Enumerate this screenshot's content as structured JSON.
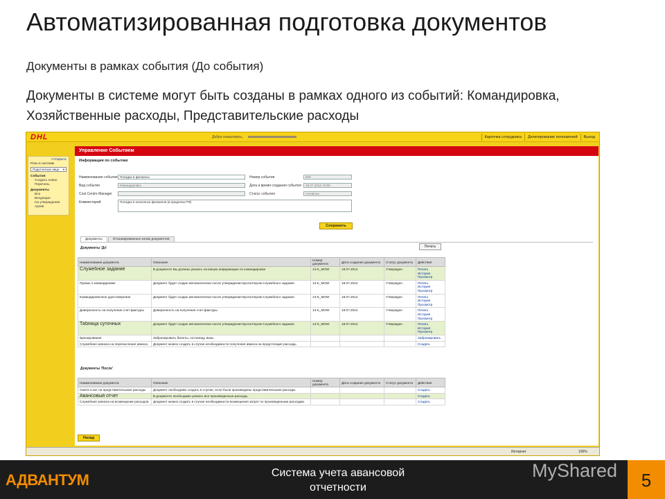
{
  "slide": {
    "title": "Автоматизированная подготовка документов",
    "subtitle": "Документы в рамках события (До события)",
    "body": "Документы в системе могут быть созданы в рамках одного из событий: Командировка, Хозяйственные расходы, Представительские расходы"
  },
  "app": {
    "logo": "DHL",
    "welcome": "Добро пожаловать,",
    "top_links": [
      "Карточка сотрудника",
      "Делегирование полномочий",
      "Выход"
    ],
    "page_title": "Управление Событием",
    "sidebar": {
      "hide": "<<Скрыть",
      "role_label": "Роль в системе",
      "role_value": "Подотчетное лицо",
      "events_label": "События",
      "events_items": [
        "Создать новое",
        "Перечень"
      ],
      "docs_label": "Документы",
      "docs_items": [
        "Все",
        "Входящие",
        "На утверждение",
        "Архив"
      ]
    },
    "info_title": "Информация по событию",
    "form": {
      "event_name_label": "Наименование события",
      "event_name_value": "Поездка в филиалы",
      "event_number_label": "Номер события",
      "event_number_value": "809",
      "event_type_label": "Вид события",
      "event_type_value": "Командировка",
      "created_label": "Дата и время создания события",
      "created_value": "18.07.2012 10:08",
      "ccm_label": "Cost Centre Manager",
      "status_label": "Статус события",
      "status_value": "Активное",
      "comment_label": "Комментарий",
      "comment_value": "Поездка в несколько филиалов (в пределах РФ)",
      "save_button": "Сохранить"
    },
    "tabs": [
      "Документы",
      "Отсканированные копии документов"
    ],
    "print_button": "Печать",
    "docs_before_label": "Документы 'До'",
    "docs_after_label": "Документы 'После'",
    "columns": [
      "Наименование документа",
      "Описание",
      "Номер документа",
      "Дата создания документа",
      "Статус документа",
      "Действия"
    ],
    "rows_before": [
      {
        "name": "Служебное задание",
        "desc": "В документе Вы должны указать основную информацию по командировке",
        "num": "13-K_MOW",
        "date": "18.07.2012",
        "status": "Утвержден",
        "actions": [
          "Печать",
          "История",
          "Просмотр"
        ],
        "hl": true
      },
      {
        "name": "Приказ о командировке",
        "desc": "Документ будет создан автоматически после утверждения Бухгалтером Служебного задания.",
        "num": "13-K_MOW",
        "date": "18.07.2012",
        "status": "Утвержден",
        "actions": [
          "Печать",
          "История",
          "Просмотр"
        ],
        "hl": false
      },
      {
        "name": "Командировочное удостоверение",
        "desc": "Документ будет создан автоматически после утверждения Бухгалтером Служебного задания.",
        "num": "13-K_MOW",
        "date": "18.07.2012",
        "status": "Утвержден",
        "actions": [
          "Печать",
          "История",
          "Просмотр"
        ],
        "hl": false
      },
      {
        "name": "Доверенность на получение счет-фактуры",
        "desc": "Доверенность на получение счет-фактуры",
        "num": "13-K_MOW",
        "date": "18.07.2012",
        "status": "Утвержден",
        "actions": [
          "Печать",
          "История",
          "Просмотр"
        ],
        "hl": false
      },
      {
        "name": "Таблица суточных",
        "desc": "Документ будет создан автоматически после утверждения Бухгалтером Служебного задания.",
        "num": "13-K_MOW",
        "date": "18.07.2012",
        "status": "Утвержден",
        "actions": [
          "Печать",
          "История",
          "Просмотр"
        ],
        "hl": true
      },
      {
        "name": "Бронирование",
        "desc": "Забронировать билеты, гостиницу, визы",
        "num": "",
        "date": "",
        "status": "",
        "actions": [
          "Забронировать"
        ],
        "hl": false
      },
      {
        "name": "Служебная записка на перечисление аванса",
        "desc": "Документ можно создать в случае необходимости получения аванса на предстоящие расходы.",
        "num": "",
        "date": "",
        "status": "",
        "actions": [
          "Создать"
        ],
        "hl": false
      }
    ],
    "rows_after": [
      {
        "name": "Смета и акт на представительские расходы",
        "desc": "Документ необходимо создать в случае, если были произведены представительские расходы.",
        "num": "",
        "date": "",
        "status": "",
        "actions": [
          "Создать"
        ],
        "hl": false
      },
      {
        "name": "Авансовый отчет",
        "desc": "В документе необходимо указать все произведенные расходы.",
        "num": "",
        "date": "",
        "status": "",
        "actions": [
          "Создать"
        ],
        "hl": true
      },
      {
        "name": "Служебная записка на возмещение расходов",
        "desc": "Документ можно создать в случае необходимости возмещения затрат по произведенным расходам.",
        "num": "",
        "date": "",
        "status": "",
        "actions": [
          "Создать"
        ],
        "hl": false
      }
    ],
    "back_button": "Назад",
    "statusbar_internet": "Интернет",
    "statusbar_zoom": "100%"
  },
  "footer": {
    "logo": "АДВАНТУМ",
    "title": "Система учета авансовой отчетности",
    "watermark": "MyShared",
    "page_number": "5"
  },
  "colors": {
    "accent": "#f28c00",
    "dhl_yellow": "#f7d31a",
    "dhl_red": "#d40511",
    "footer_bg": "#1c1c1c"
  }
}
